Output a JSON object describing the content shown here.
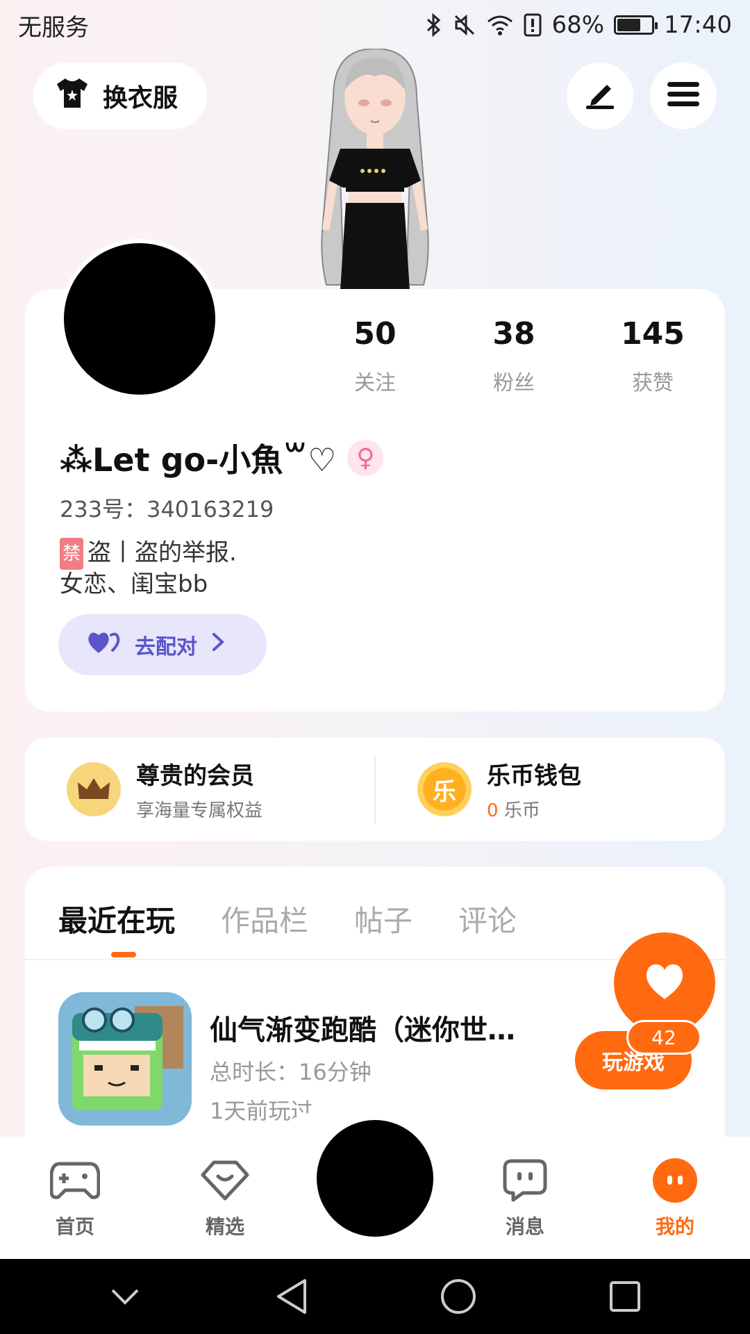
{
  "status": {
    "left_text": "无服务",
    "battery": "68%",
    "battery_fraction": 0.68,
    "time": "17:40"
  },
  "header": {
    "outfit_label": "换衣服"
  },
  "stats": [
    {
      "value": "50",
      "label": "关注"
    },
    {
      "value": "38",
      "label": "粉丝"
    },
    {
      "value": "145",
      "label": "获赞"
    }
  ],
  "profile": {
    "username": "⁂Let go-小魚꒳♡",
    "gender_symbol": "♀",
    "user_id": "233号：340163219",
    "bio_badge": "禁",
    "bio_line1": "盗丨盗的举报.",
    "bio_line2": "女恋、闺宝bb",
    "match_label": "去配对"
  },
  "wallet": {
    "vip_title": "尊贵的会员",
    "vip_sub": "享海量专属权益",
    "coin_title": "乐币钱包",
    "coin_amount": "0",
    "coin_unit": "乐币",
    "coin_glyph": "乐"
  },
  "tabs": [
    "最近在玩",
    "作品栏",
    "帖子",
    "评论"
  ],
  "recent_game": {
    "title": "仙气渐变跑酷（迷你世…",
    "total_time": "总时长：16分钟",
    "last_played": "1天前玩过",
    "play_label": "玩游戏"
  },
  "like": {
    "count": "42"
  },
  "bottom_nav": [
    {
      "label": "首页",
      "icon": "gamepad-icon"
    },
    {
      "label": "精选",
      "icon": "heart-shield-icon"
    },
    {
      "label": "消息",
      "icon": "chat-icon"
    },
    {
      "label": "我的",
      "icon": "profile-face-icon"
    }
  ],
  "colors": {
    "accent": "#ff6a10",
    "match_bg": "#e7e6fb",
    "match_text": "#5b55c8"
  }
}
